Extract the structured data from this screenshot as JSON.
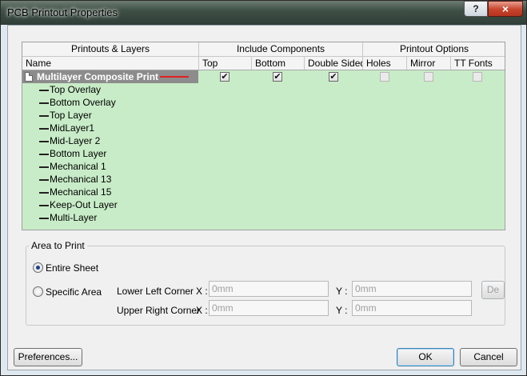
{
  "window": {
    "title": "PCB Printout Properties",
    "help_glyph": "?",
    "close_glyph": "×"
  },
  "grid": {
    "group_headers": [
      "Printouts & Layers",
      "Include Components",
      "Printout Options"
    ],
    "columns": [
      "Name",
      "Top",
      "Bottom",
      "Double Sided",
      "Holes",
      "Mirror",
      "TT Fonts"
    ],
    "composite": {
      "label": "Multilayer Composite Print",
      "top": true,
      "bottom": true,
      "double_sided": true,
      "holes": false,
      "mirror": false,
      "tt_fonts": false
    },
    "layers": [
      "Top Overlay",
      "Bottom Overlay",
      "Top Layer",
      "MidLayer1",
      "Mid-Layer 2",
      "Bottom Layer",
      "Mechanical 1",
      "Mechanical 13",
      "Mechanical 15",
      "Keep-Out Layer",
      "Multi-Layer"
    ],
    "check_glyph": "✔"
  },
  "area": {
    "title": "Area to Print",
    "entire_sheet": "Entire Sheet",
    "specific_area": "Specific Area",
    "selected": "Entire Sheet",
    "lower_left": "Lower Left Corner",
    "upper_right": "Upper Right Corner",
    "x_label": "X :",
    "y_label": "Y :",
    "placeholder": "0mm",
    "define_button": "De"
  },
  "buttons": {
    "preferences": "Preferences...",
    "ok": "OK",
    "cancel": "Cancel"
  },
  "colors": {
    "grid_bg": "#c8ecc8",
    "selected_row": "#8c8c8c",
    "marker": "#e02020"
  }
}
